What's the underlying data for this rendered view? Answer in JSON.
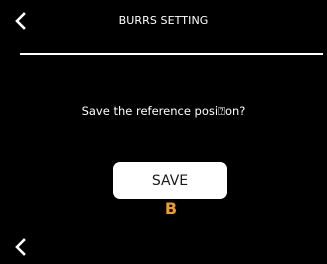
{
  "header": {
    "title": "BURRS SETTING",
    "back_icon": "chevron-left-icon"
  },
  "main": {
    "prompt": "Save the reference posi⍰on?",
    "save_label": "SAVE",
    "marker": "B",
    "marker_color": "#f0a020"
  },
  "footer": {
    "back_icon": "chevron-left-icon"
  },
  "colors": {
    "background": "#000000",
    "foreground": "#ffffff"
  }
}
